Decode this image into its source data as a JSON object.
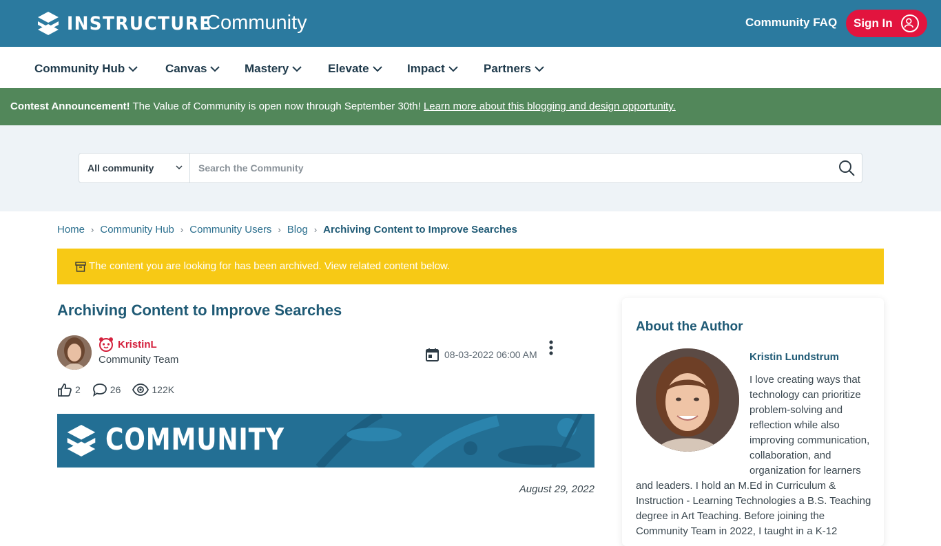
{
  "header": {
    "brand": "INSTRUCTURE",
    "community": "Community",
    "faq": "Community FAQ",
    "sign_in": "Sign In"
  },
  "nav": {
    "items": [
      {
        "label": "Community Hub"
      },
      {
        "label": "Canvas"
      },
      {
        "label": "Mastery"
      },
      {
        "label": "Elevate"
      },
      {
        "label": "Impact"
      },
      {
        "label": "Partners"
      }
    ]
  },
  "contest": {
    "bold": "Contest Announcement!",
    "text": " The Value of Community is open now through September 30th! ",
    "link": "Learn more about this blogging and design opportunity."
  },
  "search": {
    "scope": "All community",
    "placeholder": "Search the Community"
  },
  "breadcrumb": {
    "items": [
      "Home",
      "Community Hub",
      "Community Users",
      "Blog"
    ],
    "current": "Archiving Content to Improve Searches"
  },
  "archive_notice": "The content you are looking for has been archived. View related content below.",
  "article": {
    "title": "Archiving Content to Improve Searches",
    "author": "KristinL",
    "role": "Community Team",
    "datetime": "08-03-2022 06:00 AM",
    "likes": "2",
    "comments": "26",
    "views": "122K",
    "hero_text": "COMMUNITY",
    "post_date": "August 29, 2022"
  },
  "about": {
    "title": "About the Author",
    "name": "Kristin Lundstrum",
    "bio": "I love creating ways that technology can prioritize problem-solving and reflection while also improving communication, collaboration, and organization for learners and leaders. I hold an M.Ed in Curriculum & Instruction - Learning Technologies a B.S. Teaching degree in Art Teaching. Before joining the Community Team in 2022, I taught in a K-12"
  },
  "colors": {
    "header_bg": "#2b7a9f",
    "sign_in_bg": "#e2143e",
    "contest_bg": "#52875a",
    "archive_bg": "#f7c915",
    "title_blue": "#1f5a75"
  }
}
